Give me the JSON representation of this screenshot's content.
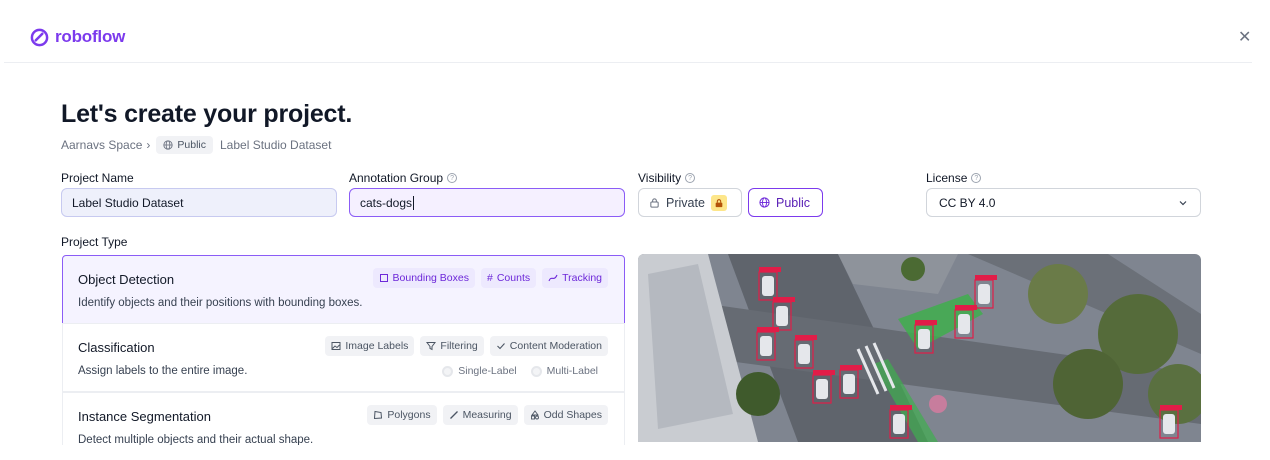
{
  "brand": {
    "name": "roboflow",
    "color": "#7c3aed"
  },
  "header": {
    "close_icon": "close-icon"
  },
  "page": {
    "title": "Let's create your project."
  },
  "breadcrumb": {
    "workspace": "Aarnavs Space",
    "visibility_badge": "Public",
    "project": "Label Studio Dataset"
  },
  "form": {
    "project_name": {
      "label": "Project Name",
      "value": "Label Studio Dataset"
    },
    "annotation_group": {
      "label": "Annotation Group",
      "value": "cats-dogs"
    },
    "visibility": {
      "label": "Visibility",
      "options": [
        "Private",
        "Public"
      ],
      "selected": "Public"
    },
    "license": {
      "label": "License",
      "value": "CC BY 4.0"
    },
    "project_type_label": "Project Type"
  },
  "project_types": [
    {
      "title": "Object Detection",
      "description": "Identify objects and their positions with bounding boxes.",
      "selected": true,
      "tags": [
        "Bounding Boxes",
        "Counts",
        "Tracking"
      ]
    },
    {
      "title": "Classification",
      "description": "Assign labels to the entire image.",
      "selected": false,
      "tags": [
        "Image Labels",
        "Filtering",
        "Content Moderation"
      ],
      "sub_options": [
        "Single-Label",
        "Multi-Label"
      ]
    },
    {
      "title": "Instance Segmentation",
      "description": "Detect multiple objects and their actual shape.",
      "selected": false,
      "tags": [
        "Polygons",
        "Measuring",
        "Odd Shapes"
      ]
    }
  ],
  "preview": {
    "icon": "aerial-intersection-preview-image",
    "box_color": "#e11d48"
  }
}
